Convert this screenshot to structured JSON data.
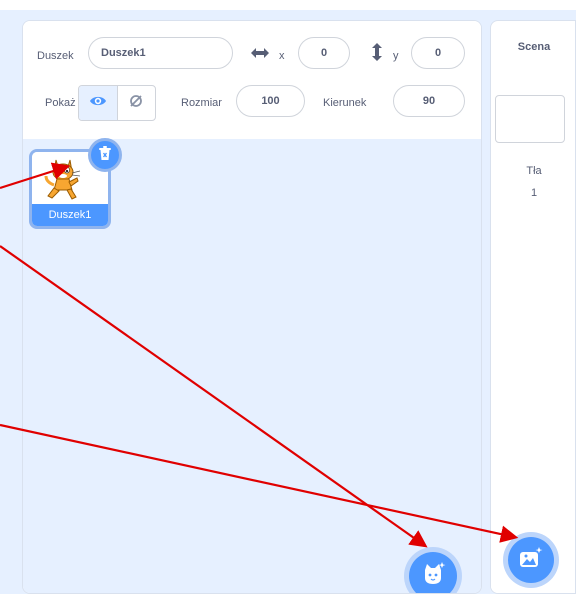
{
  "sprite_info": {
    "sprite_label": "Duszek",
    "sprite_name": "Duszek1",
    "x_label": "x",
    "x_value": "0",
    "y_label": "y",
    "y_value": "0",
    "show_label": "Pokaż",
    "size_label": "Rozmiar",
    "size_value": "100",
    "direction_label": "Kierunek",
    "direction_value": "90"
  },
  "sprites": [
    {
      "name": "Duszek1",
      "selected": true
    }
  ],
  "stage": {
    "header": "Scena",
    "backdrops_label": "Tła",
    "backdrops_count": "1"
  },
  "colors": {
    "accent": "#4c97ff",
    "pane_bg": "#e6f0ff",
    "text": "#575e75",
    "annotation_arrow": "#e00000"
  },
  "icons": {
    "x": "horizontal-double-arrow-icon",
    "y": "vertical-double-arrow-icon",
    "show": "eye-icon",
    "hide": "eye-slash-icon",
    "delete": "trash-icon",
    "choose_sprite": "cat-plus-icon",
    "choose_backdrop": "image-plus-icon"
  }
}
